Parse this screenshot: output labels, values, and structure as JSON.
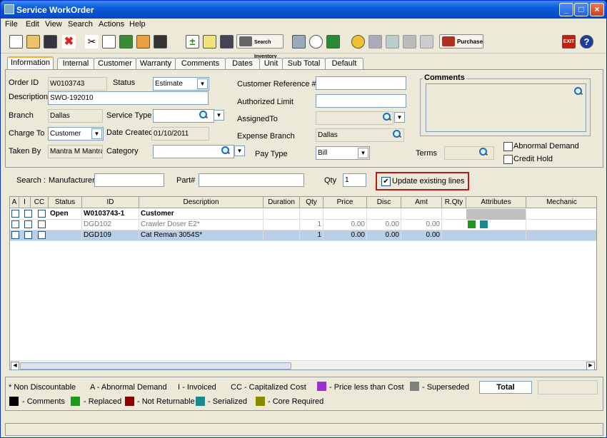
{
  "window": {
    "title": "Service WorkOrder"
  },
  "menu": [
    "File",
    "Edit",
    "View",
    "Search",
    "Actions",
    "Help"
  ],
  "toolbar": {
    "search_inventory": "Search Inventory",
    "purchase": "Purchase"
  },
  "tabs": [
    "Information",
    "Internal",
    "Customer",
    "Warranty",
    "Comments",
    "Dates",
    "Unit",
    "Sub Total",
    "Default"
  ],
  "info": {
    "order_id_label": "Order ID",
    "order_id": "W0103743",
    "status_label": "Status",
    "status": "Estimate",
    "description_label": "Description",
    "description": "SWO-192010",
    "branch_label": "Branch",
    "branch": "Dallas",
    "service_type_label": "Service Type",
    "service_type": "",
    "charge_to_label": "Charge To",
    "charge_to": "Customer",
    "date_created_label": "Date Created",
    "date_created": "01/10/2011",
    "taken_by_label": "Taken By",
    "taken_by": "Mantra M Mantra",
    "category_label": "Category",
    "category": "",
    "customer_ref_label": "Customer Reference #",
    "customer_ref": "",
    "authorized_limit_label": "Authorized Limit",
    "authorized_limit": "",
    "assigned_to_label": "AssignedTo",
    "assigned_to": "",
    "expense_branch_label": "Expense Branch",
    "expense_branch": "Dallas",
    "pay_type_label": "Pay Type",
    "pay_type": "Bill",
    "comments_label": "Comments",
    "terms_label": "Terms",
    "abnormal_demand_label": "Abnormal Demand",
    "credit_hold_label": "Credit Hold"
  },
  "search": {
    "label": "Search :",
    "manufacturer_label": "Manufacturer",
    "part_label": "Part#",
    "qty_label": "Qty",
    "qty": "1",
    "update_label": "Update existing lines"
  },
  "grid": {
    "headers": [
      "A",
      "I",
      "CC",
      "Status",
      "ID",
      "Description",
      "Duration",
      "Qty",
      "Price",
      "Disc",
      "Amt",
      "R.Qty",
      "Attributes",
      "Mechanic"
    ],
    "rows": [
      {
        "status": "Open",
        "id": "W0103743-1",
        "description": "Customer",
        "duration": "",
        "qty": "",
        "price": "",
        "disc": "",
        "amt": ""
      },
      {
        "status": "",
        "id": "DGD102",
        "description": "Crawler Doser E2*",
        "duration": "",
        "qty": "1",
        "price": "0.00",
        "disc": "0.00",
        "amt": "0.00"
      },
      {
        "status": "",
        "id": "DGD109",
        "description": "Cat Reman 3054S*",
        "duration": "",
        "qty": "1",
        "price": "0.00",
        "disc": "0.00",
        "amt": "0.00"
      }
    ]
  },
  "legend": {
    "non_discountable": "* Non Discountable",
    "abnormal": "A - Abnormal Demand",
    "invoiced": "I - Invoiced",
    "capitalized": "CC - Capitalized Cost",
    "price_less": "- Price less than Cost",
    "superseded": "- Superseded",
    "total": "Total",
    "comments": "- Comments",
    "replaced": "- Replaced",
    "not_returnable": "- Not Returnable",
    "serialized": "- Serialized",
    "core_required": "- Core Required"
  },
  "colors": {
    "purple": "#9b30d0",
    "gray": "#808080",
    "black": "#000000",
    "green": "#1a9a1a",
    "darkred": "#8b0000",
    "teal": "#1a8a8a",
    "olive": "#8a8a00"
  }
}
